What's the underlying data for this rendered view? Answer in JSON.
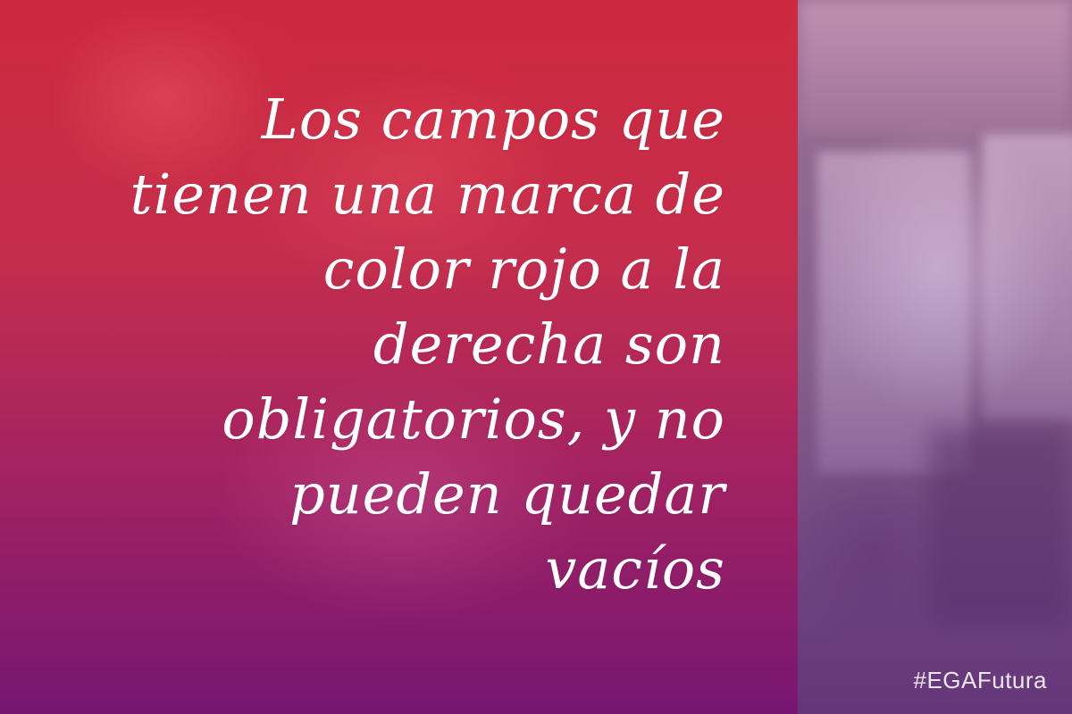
{
  "quote": {
    "text": "Los campos que\ntienen una marca de\ncolor rojo a la\nderecha son\nobligatorios, y no\npueden quedar\nvacíos"
  },
  "hashtag": "#EGAFutura",
  "colors": {
    "overlay_top": "#d22337",
    "overlay_bottom": "#781473",
    "text": "#ffffff"
  }
}
